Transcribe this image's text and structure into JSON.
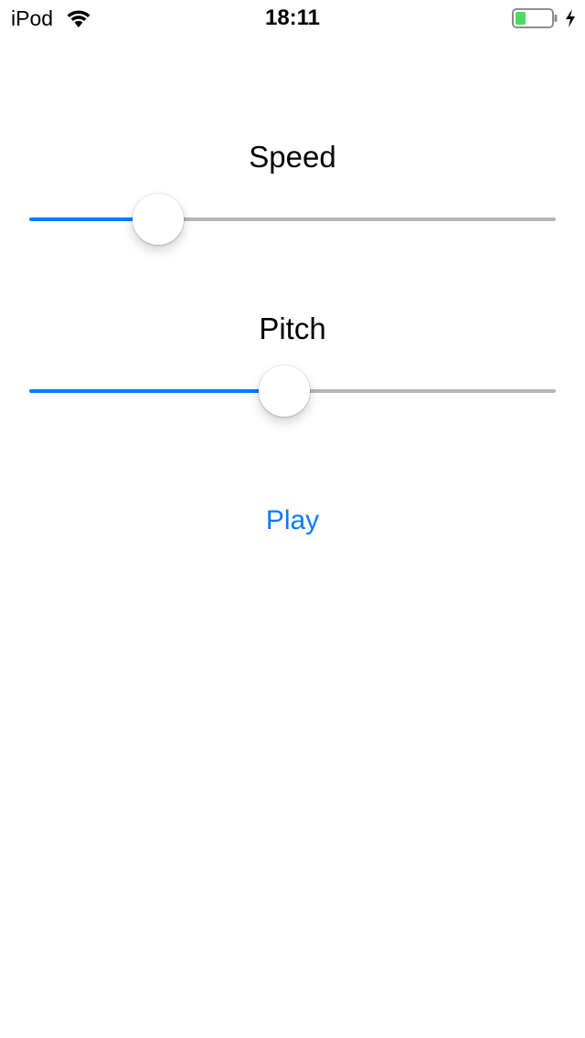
{
  "status_bar": {
    "carrier": "iPod",
    "time": "18:11",
    "battery_level": 0.3,
    "battery_color": "#4cd964",
    "charging": true
  },
  "sliders": [
    {
      "label": "Speed",
      "value": 0.245
    },
    {
      "label": "Pitch",
      "value": 0.485
    }
  ],
  "play_button": {
    "label": "Play"
  },
  "colors": {
    "accent": "#0a7aff",
    "track": "#b6b6b6"
  }
}
